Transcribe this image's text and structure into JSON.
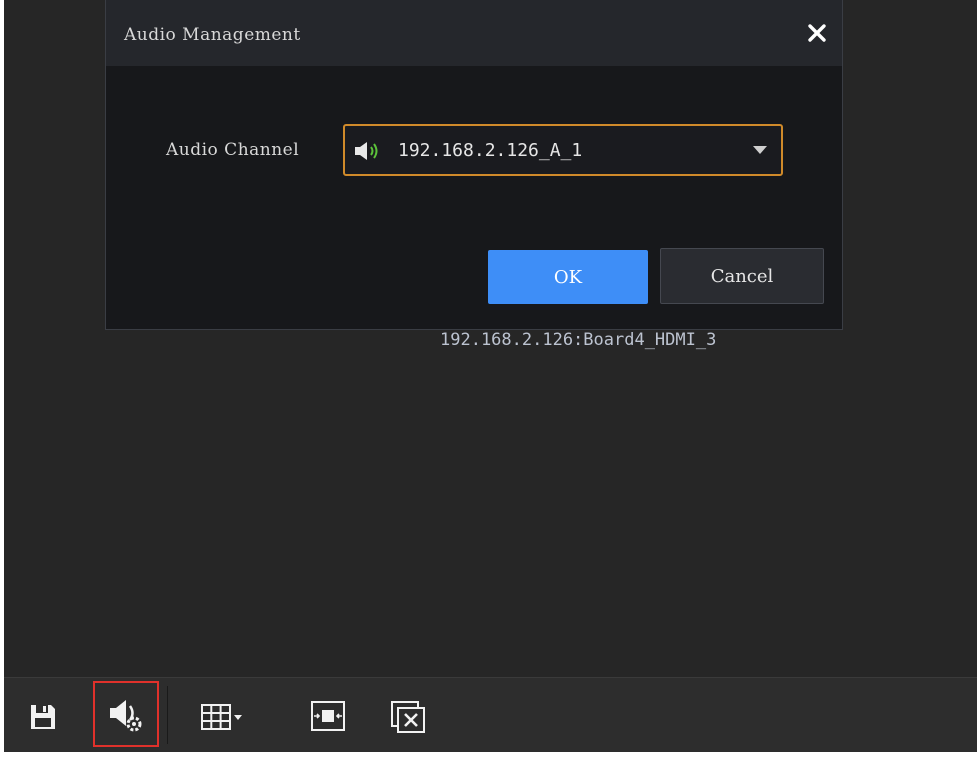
{
  "dialog": {
    "title": "Audio Management",
    "audio_channel_label": "Audio Channel",
    "audio_channel_value": "192.168.2.126_A_1",
    "ok_label": "OK",
    "cancel_label": "Cancel"
  },
  "background": {
    "channel_label": "192.168.2.126:Board4_HDMI_3"
  },
  "toolbar": {
    "buttons": [
      {
        "name": "save",
        "icon": "floppy-disk-icon"
      },
      {
        "name": "audio-management",
        "icon": "speaker-settings-icon",
        "highlighted": true
      },
      {
        "name": "layout",
        "icon": "grid-dropdown-icon"
      },
      {
        "name": "fit-window",
        "icon": "fit-window-icon"
      },
      {
        "name": "close-window",
        "icon": "close-window-icon"
      }
    ]
  },
  "colors": {
    "accent": "#3e8ef7",
    "focus_border": "#d08a2a",
    "highlight": "#e0312b",
    "background": "#262626",
    "dialog": "#17181b"
  }
}
